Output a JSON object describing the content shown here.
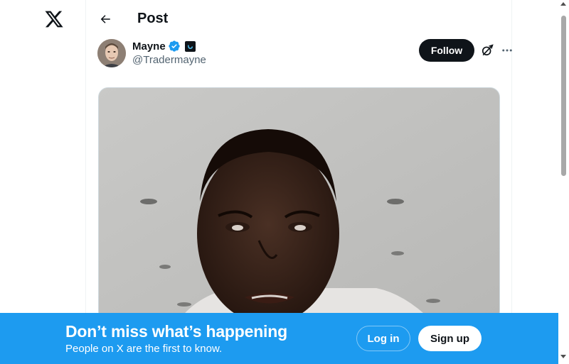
{
  "header": {
    "title": "Post"
  },
  "post": {
    "author_name": "Mayne",
    "author_handle": "@Tradermayne",
    "follow_label": "Follow"
  },
  "banner": {
    "headline": "Don’t miss what’s happening",
    "subtext": "People on X are the first to know.",
    "login_label": "Log in",
    "signup_label": "Sign up"
  },
  "colors": {
    "brand": "#1d9bf0",
    "text": "#0f1419",
    "secondary": "#536471"
  },
  "icons": [
    "x-logo-icon",
    "back-arrow-icon",
    "verified-badge-icon",
    "affiliate-badge-icon",
    "grok-icon",
    "more-icon"
  ]
}
